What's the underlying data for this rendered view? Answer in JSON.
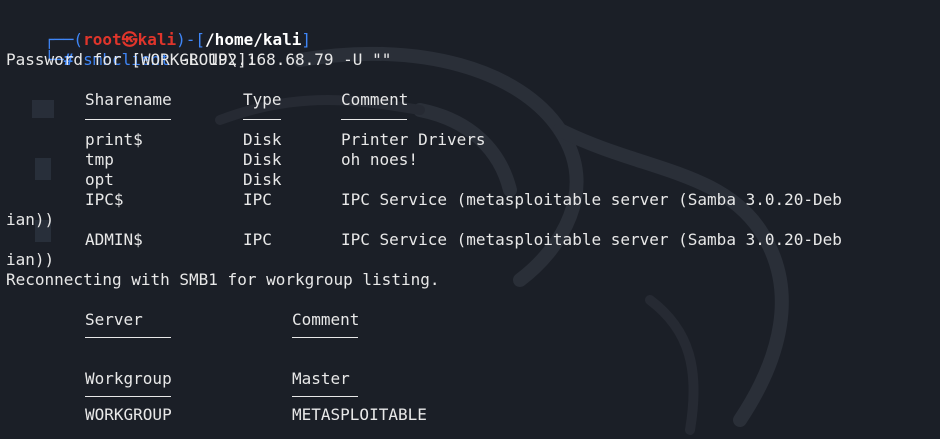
{
  "prompt": {
    "user": "root",
    "skull_glyph": "㉿",
    "host": "kali",
    "path": "/home/kali",
    "hash": "#",
    "command": "smbclient",
    "args": " -L 192.168.68.79 -U \"\""
  },
  "password_prompt": "Password for [WORKGROUP\\]:",
  "shares": {
    "headers": {
      "name": "Sharename",
      "type": "Type",
      "comment": "Comment"
    },
    "rows": [
      {
        "name": "print$",
        "type": "Disk",
        "comment": "Printer Drivers"
      },
      {
        "name": "tmp",
        "type": "Disk",
        "comment": "oh noes!"
      },
      {
        "name": "opt",
        "type": "Disk",
        "comment": ""
      },
      {
        "name": "IPC$",
        "type": "IPC",
        "comment": "IPC Service (metasploitable server (Samba 3.0.20-Deb",
        "wrap": "ian))"
      },
      {
        "name": "ADMIN$",
        "type": "IPC",
        "comment": "IPC Service (metasploitable server (Samba 3.0.20-Deb",
        "wrap": "ian))"
      }
    ]
  },
  "reconnect_message": "Reconnecting with SMB1 for workgroup listing.",
  "servers": {
    "headers": {
      "name": "Server",
      "comment": "Comment"
    }
  },
  "workgroups": {
    "headers": {
      "name": "Workgroup",
      "master": "Master"
    },
    "rows": [
      {
        "name": "WORKGROUP",
        "master": "METASPLOITABLE"
      }
    ]
  }
}
